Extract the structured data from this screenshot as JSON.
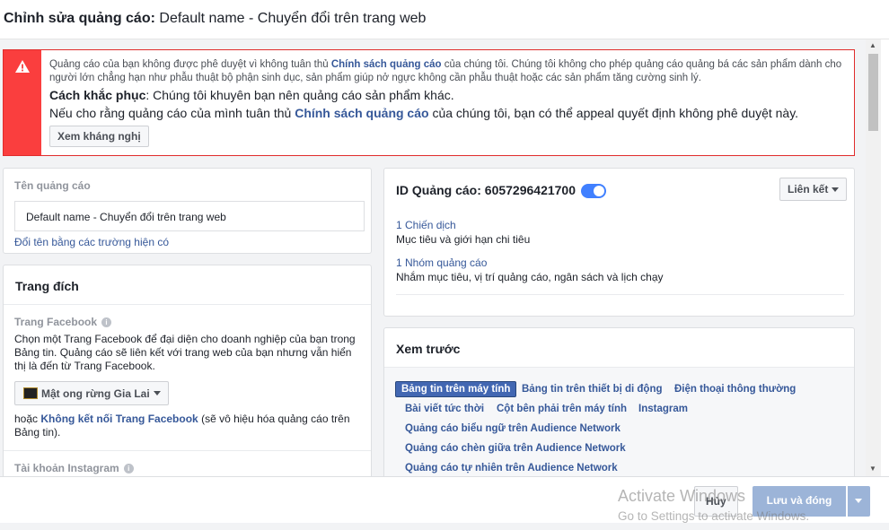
{
  "header": {
    "title_bold": "Chỉnh sửa quảng cáo:",
    "title_name": "Default name - Chuyển đổi trên trang web"
  },
  "alert": {
    "line1_pre": "Quảng cáo của bạn không được phê duyệt vì không tuân thủ",
    "line1_link": "Chính sách quảng cáo",
    "line1_post": "của chúng tôi. Chúng tôi không cho phép quảng cáo quảng bá các sản phẩm dành cho người lớn chẳng hạn như phẫu thuật bộ phận sinh dục, sản phẩm giúp nở ngực không cần phẫu thuật hoặc các sản phẩm tăng cường sinh lý.",
    "fix_label": "Cách khắc phục",
    "fix_text": ": Chúng tôi khuyên bạn nên quảng cáo sản phẩm khác.",
    "appeal_pre": "Nếu cho rằng quảng cáo của mình tuân thủ",
    "appeal_link": "Chính sách quảng cáo",
    "appeal_post": "của chúng tôi, bạn có thể appeal quyết định không phê duyệt này.",
    "button": "Xem kháng nghị"
  },
  "ad_name": {
    "label": "Tên quảng cáo",
    "value": "Default name - Chuyển đổi trên trang web",
    "rename_link": "Đổi tên bằng các trường hiện có"
  },
  "destination": {
    "title": "Trang đích",
    "fb_page_label": "Trang Facebook",
    "fb_page_desc": "Chọn một Trang Facebook để đại diện cho doanh nghiệp của bạn trong Bảng tin. Quảng cáo sẽ liên kết với trang web của bạn nhưng vẫn hiển thị là đến từ Trang Facebook.",
    "fb_page_selected": "Mật ong rừng Gia Lai",
    "or_pre": "hoặc",
    "or_link": "Không kết nối Trang Facebook",
    "or_post": "(sẽ vô hiệu hóa quảng cáo trên Bảng tin).",
    "instagram_label": "Tài khoản Instagram"
  },
  "ad_id": {
    "label": "ID Quảng cáo: 6057296421700",
    "link_button": "Liên kết",
    "campaign_link": "1 Chiến dịch",
    "campaign_desc": "Mục tiêu và giới hạn chi tiêu",
    "adset_link": "1 Nhóm quảng cáo",
    "adset_desc": "Nhắm mục tiêu, vị trí quảng cáo, ngân sách và lịch chạy"
  },
  "preview": {
    "title": "Xem trước",
    "tabs": [
      "Bảng tin trên máy tính",
      "Bảng tin trên thiết bị di động",
      "Điện thoại thông thường",
      "Bài viết tức thời",
      "Cột bên phải trên máy tính",
      "Instagram",
      "Quảng cáo biểu ngữ trên Audience Network",
      "Quảng cáo chèn giữa trên Audience Network",
      "Quảng cáo tự nhiên trên Audience Network"
    ]
  },
  "footer": {
    "cancel": "Hủy",
    "save": "Lưu và đóng"
  },
  "watermark": {
    "line1": "Activate Windows",
    "line2": "Go to Settings to activate Windows."
  },
  "colors": {
    "alert_red": "#fa3e3e",
    "link_blue": "#365899",
    "primary_blue": "#4267b2",
    "toggle_blue": "#4080ff"
  }
}
